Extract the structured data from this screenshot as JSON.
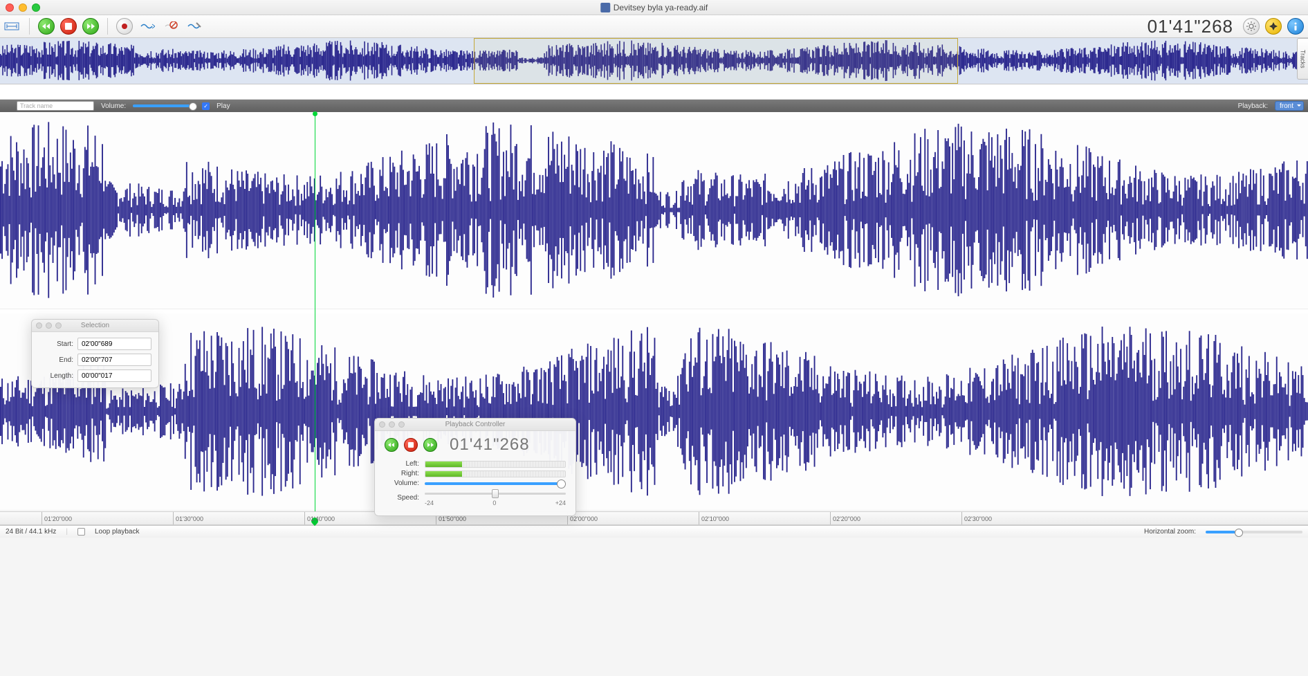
{
  "window": {
    "title": "Devitsey byla ya-ready.aif"
  },
  "toolbar": {
    "timecode": "01'41\"268"
  },
  "tracks_tab": "Tracks",
  "trackbar": {
    "trackname_placeholder": "Track name",
    "volume_label": "Volume:",
    "play_label": "Play",
    "playback_label": "Playback:",
    "playback_value": "front"
  },
  "ruler": {
    "ticks": [
      "01'20\"000",
      "01'30\"000",
      "01'40\"000",
      "01'50\"000",
      "02'00\"000",
      "02'10\"000",
      "02'20\"000",
      "02'30\"000"
    ]
  },
  "status": {
    "format": "24 Bit / 44.1 kHz",
    "loop_label": "Loop playback",
    "hzoom_label": "Horizontal zoom:"
  },
  "selection_panel": {
    "title": "Selection",
    "start_label": "Start:",
    "end_label": "End:",
    "length_label": "Length:",
    "start": "02'00\"689",
    "end": "02'00\"707",
    "length": "00'00\"017"
  },
  "playback_panel": {
    "title": "Playback Controller",
    "time": "01'41\"268",
    "left_label": "Left:",
    "right_label": "Right:",
    "volume_label": "Volume:",
    "speed_label": "Speed:",
    "speed_min": "-24",
    "speed_mid": "0",
    "speed_max": "+24"
  }
}
